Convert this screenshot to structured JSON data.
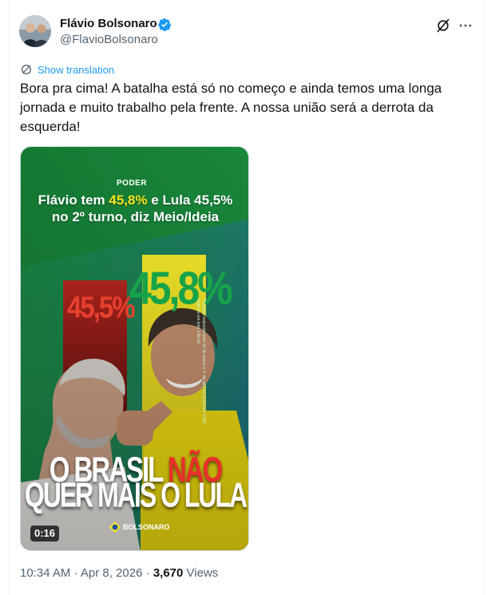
{
  "author": {
    "display_name": "Flávio Bolsonaro",
    "handle": "@FlavioBolsonaro",
    "avatar_icon": "avatar-photo",
    "verified_icon": "verified-badge-icon",
    "verified_color": "#1d9bf0"
  },
  "header_actions": {
    "grok_icon": "grok-icon",
    "more_icon": "more-icon"
  },
  "translate": {
    "label": "Show translation",
    "icon": "globe-icon",
    "color": "#1d9bf0"
  },
  "tweet": {
    "text": "Bora pra cima! A batalha está só no começo e ainda temos uma longa jornada e muito trabalho pela frente. A nossa união será a derrota da esquerda!"
  },
  "media": {
    "type": "video",
    "duration": "0:16",
    "brand": "PODER",
    "headline_part1": "Flávio tem ",
    "headline_highlight": "45,8%",
    "headline_part2": " e Lula 45,5% no 2º turno, diz Meio/Ideia",
    "percent_lula": "45,5%",
    "percent_flavio": "45,8%",
    "side_text": "Pesquisa realizada entre 31 de março e 1º de abril de 2026 com 1.500 eleitores em todo o Brasil",
    "slogan_part1": "O BRASIL ",
    "slogan_part2": "NÃO",
    "slogan_line2": "QUER MAIS O LULA",
    "logo_text": "BOLSONARO",
    "colors": {
      "green_bg": "#1a8a3c",
      "red_bar": "#a8211c",
      "yellow_bar": "#f1e51b",
      "teal_bg": "#1f7d8c"
    }
  },
  "meta": {
    "time": "10:34 AM",
    "separator": "·",
    "date": "Apr 8, 2026",
    "views_count": "3,670",
    "views_label": "Views"
  }
}
